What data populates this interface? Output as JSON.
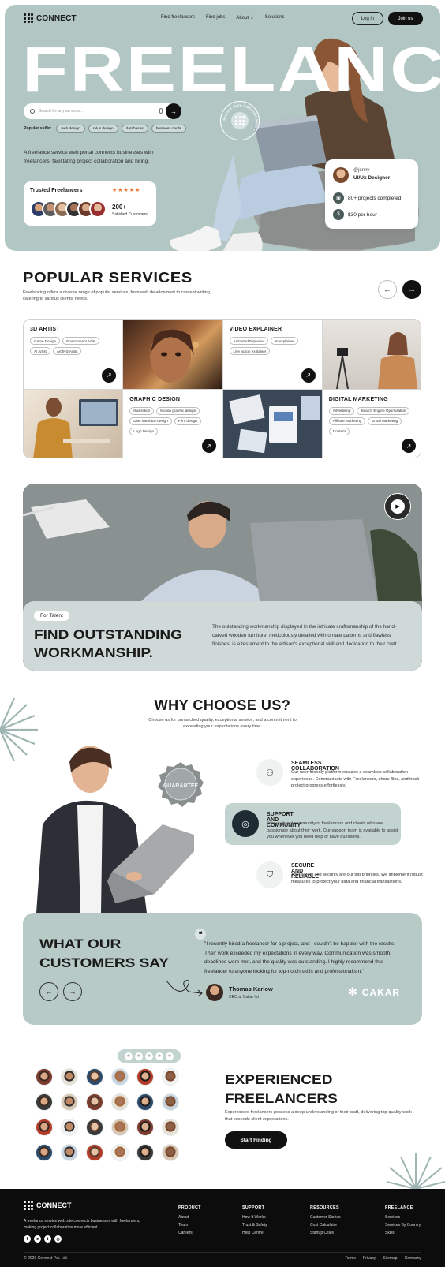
{
  "brand": {
    "name": "CONNECT"
  },
  "nav": {
    "items": [
      {
        "label": "Find freelancers"
      },
      {
        "label": "Find jobs"
      },
      {
        "label": "About ⌄"
      },
      {
        "label": "Solutions"
      }
    ],
    "login": "Log in",
    "join": "Join us"
  },
  "hero": {
    "headline": "FREELANCE",
    "search_placeholder": "Search for any services...",
    "popular_label": "Popular skills:",
    "skills": [
      "web design",
      "ralus design",
      "databases",
      "business cards"
    ],
    "description": "A freelance service web portal connects businesses with freelancers, facilitating project collaboration and hiring.",
    "trusted": {
      "title": "Trusted Freelancers",
      "stars": "★★★★★",
      "count": "200+",
      "count_label": "Satisfied Customers"
    },
    "badge_text": "discover more • discover more •",
    "profile": {
      "handle": "@jenny",
      "role": "UI/Ux Designer",
      "projects": "80+ projects completed",
      "rate": "$30 per hour"
    }
  },
  "services": {
    "title": "POPULAR SERVICES",
    "description": "Freelancing offers a diverse range of popular services, from web development to content writing, catering to various clients' needs.",
    "cards": [
      {
        "title": "3D ARTIST",
        "tags": [
          "Game Design",
          "Environment Artist",
          "AI Artist",
          "Archviz Artist"
        ]
      },
      {
        "title": "VIDEO EXPLAINER",
        "tags": [
          "Animated Explainer",
          "AI explainer",
          "Live action explainer"
        ]
      },
      {
        "title": "GRAPHIC DESIGN",
        "tags": [
          "Illustration",
          "Motion graphic design",
          "User interface design",
          "Print design",
          "Logo Design"
        ]
      },
      {
        "title": "DIGITAL MARKETING",
        "tags": [
          "Advertising",
          "Search Engine Optimization",
          "Affiliate Marketing",
          "Email Marketing",
          "Content"
        ]
      }
    ]
  },
  "talent": {
    "pill": "For Talent",
    "heading_line1": "FIND OUTSTANDING",
    "heading_line2": "WORKMANSHIP.",
    "text": "The outstanding workmanship displayed in the intricate craftsmanship of the hand-carved wooden furniture, meticulously detailed with ornate patterns and flawless finishes, is a testament to the artisan's exceptional skill and dedication to their craft.",
    "badge": "Play video"
  },
  "why": {
    "title": "WHY CHOOSE US?",
    "description": "Choose us for unmatched quality, exceptional service, and a commitment to exceeding your expectations every time.",
    "guarantee": "GUARANTEE",
    "features": [
      {
        "title": "SEAMLESS COLLABORATION",
        "text": "Our user-friendly platform ensures a seamless collaboration experience. Communicate with Freelancers, share files, and track project progress effortlessly."
      },
      {
        "title": "SUPPORT AND COMMUNITY",
        "text": "Join a vibrant community of freelancers and clients who are passionate about their work. Our support team is available to assist you whenever you need help or have questions."
      },
      {
        "title": "SECURE AND RELIABLE",
        "text": "Your safety and security are our top priorities. We implement robust measures to protect your data and financial transactions."
      }
    ]
  },
  "testimonials": {
    "heading_line1": "WHAT OUR",
    "heading_line2": "CUSTOMERS SAY",
    "quote": "\"I recently hired a freelancer for a project, and I couldn't be happier with the results. Their work exceeded my expectations in every way. Communication was smooth, deadlines were met, and the quality was outstanding. I highly recommend this freelancer to anyone looking for top-notch skills and professionalism.\"",
    "name": "Thomas Karlow",
    "role": "CEO at Cakar ltd",
    "company": "CAKAR"
  },
  "experienced": {
    "heading_line1": "EXPERIENCED",
    "heading_line2": "FREELANCERS",
    "text": "Experienced freelancers possess a deep understanding of their craft, delivering top-quality work that exceeds client expectations.",
    "cta": "Start Finding",
    "stars": [
      "★",
      "★",
      "★",
      "★",
      "★"
    ]
  },
  "footer": {
    "brand": "CONNECT",
    "description": "A freelance service web site connects businesses with freelancers, making project collaboration more efficient.",
    "columns": [
      {
        "title": "PRODUCT",
        "links": [
          "About",
          "Team",
          "Careers"
        ]
      },
      {
        "title": "SUPPORT",
        "links": [
          "How It Works",
          "Trust & Safety",
          "Help Centre"
        ]
      },
      {
        "title": "RESOURCES",
        "links": [
          "Customer Stories",
          "Cost Calculator",
          "Startup Cities"
        ]
      },
      {
        "title": "FREELANCE",
        "links": [
          "Services",
          "Services By Country",
          "Skills"
        ]
      }
    ],
    "copyright": "© 2023 Connect Pvt. Ltd.",
    "legal": [
      "Terms",
      "Privacy",
      "Sitemap",
      "Company"
    ]
  },
  "colors": {
    "hero_bg": "#b2c7c3",
    "accent_orange": "#e8742c",
    "dark": "#111111",
    "panel": "#cfdad8"
  }
}
